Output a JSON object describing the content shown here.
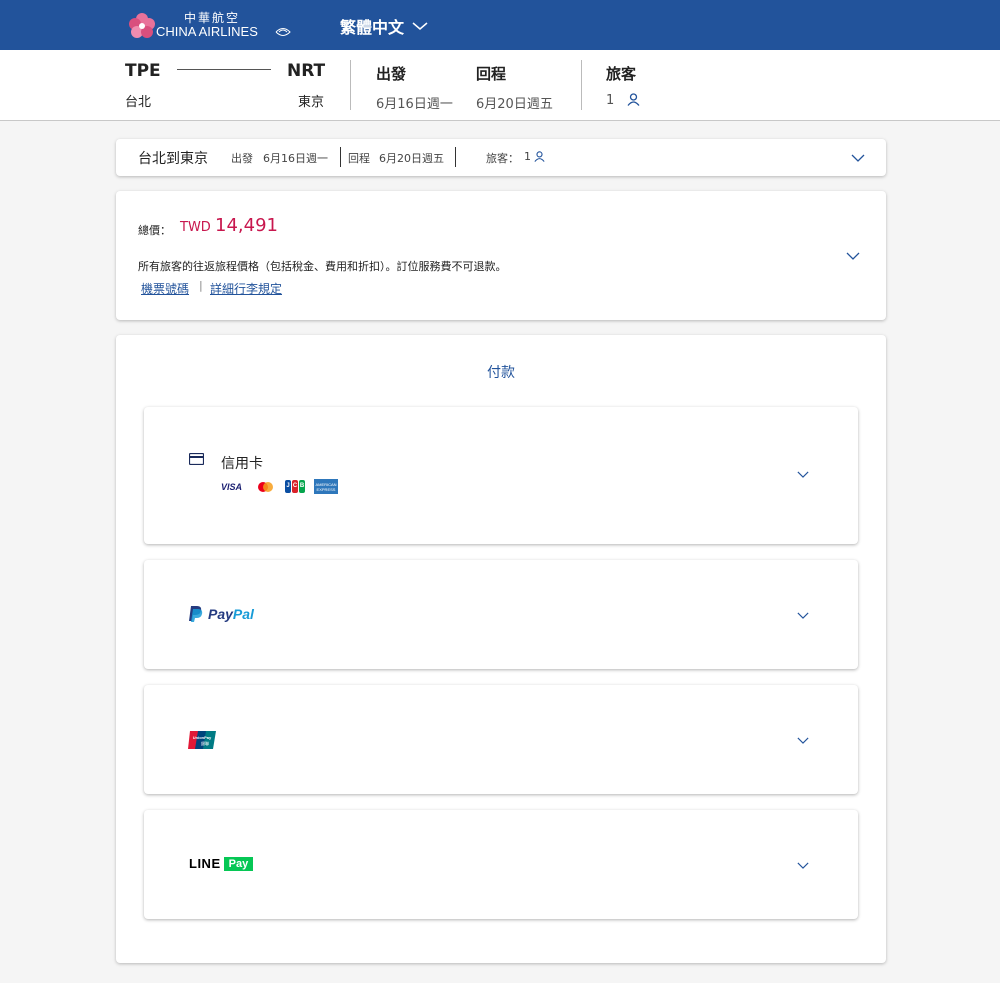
{
  "header": {
    "logo_zh": "中華航空",
    "logo_en": "CHINA AIRLINES",
    "language": "繁體中文"
  },
  "summary": {
    "origin_code": "TPE",
    "origin_city": "台北",
    "dest_code": "NRT",
    "dest_city": "東京",
    "depart_label": "出發",
    "depart_date": "6月16日週一",
    "return_label": "回程",
    "return_date": "6月20日週五",
    "passenger_label": "旅客",
    "passenger_count": "1"
  },
  "trip_bar": {
    "route": "台北到東京",
    "depart_label": "出發",
    "depart_date": "6月16日週一",
    "return_label": "回程",
    "return_date": "6月20日週五",
    "passenger_label": "旅客：",
    "passenger_count": "1"
  },
  "price": {
    "total_label": "總價：",
    "currency": "TWD",
    "amount": "14,491",
    "description": "所有旅客的往返旅程價格（包括稅金、費用和折扣）。訂位服務費不可退款。",
    "ticket_link": "機票號碼",
    "baggage_link": "詳細行李規定"
  },
  "payment": {
    "title": "付款",
    "methods": [
      {
        "label": "信用卡",
        "brands": [
          "VISA",
          "Mastercard",
          "JCB",
          "American Express"
        ]
      },
      {
        "label_part1": "Pay",
        "label_part2": "Pal"
      },
      {
        "label": "UnionPay 銀聯"
      },
      {
        "label_line": "LINE",
        "label_pay": "Pay"
      }
    ],
    "visa_text": "VISA",
    "jcb_text": "JCB"
  },
  "colors": {
    "brand_blue": "#22539b",
    "price_red": "#c8174e",
    "line_green": "#06c755"
  }
}
